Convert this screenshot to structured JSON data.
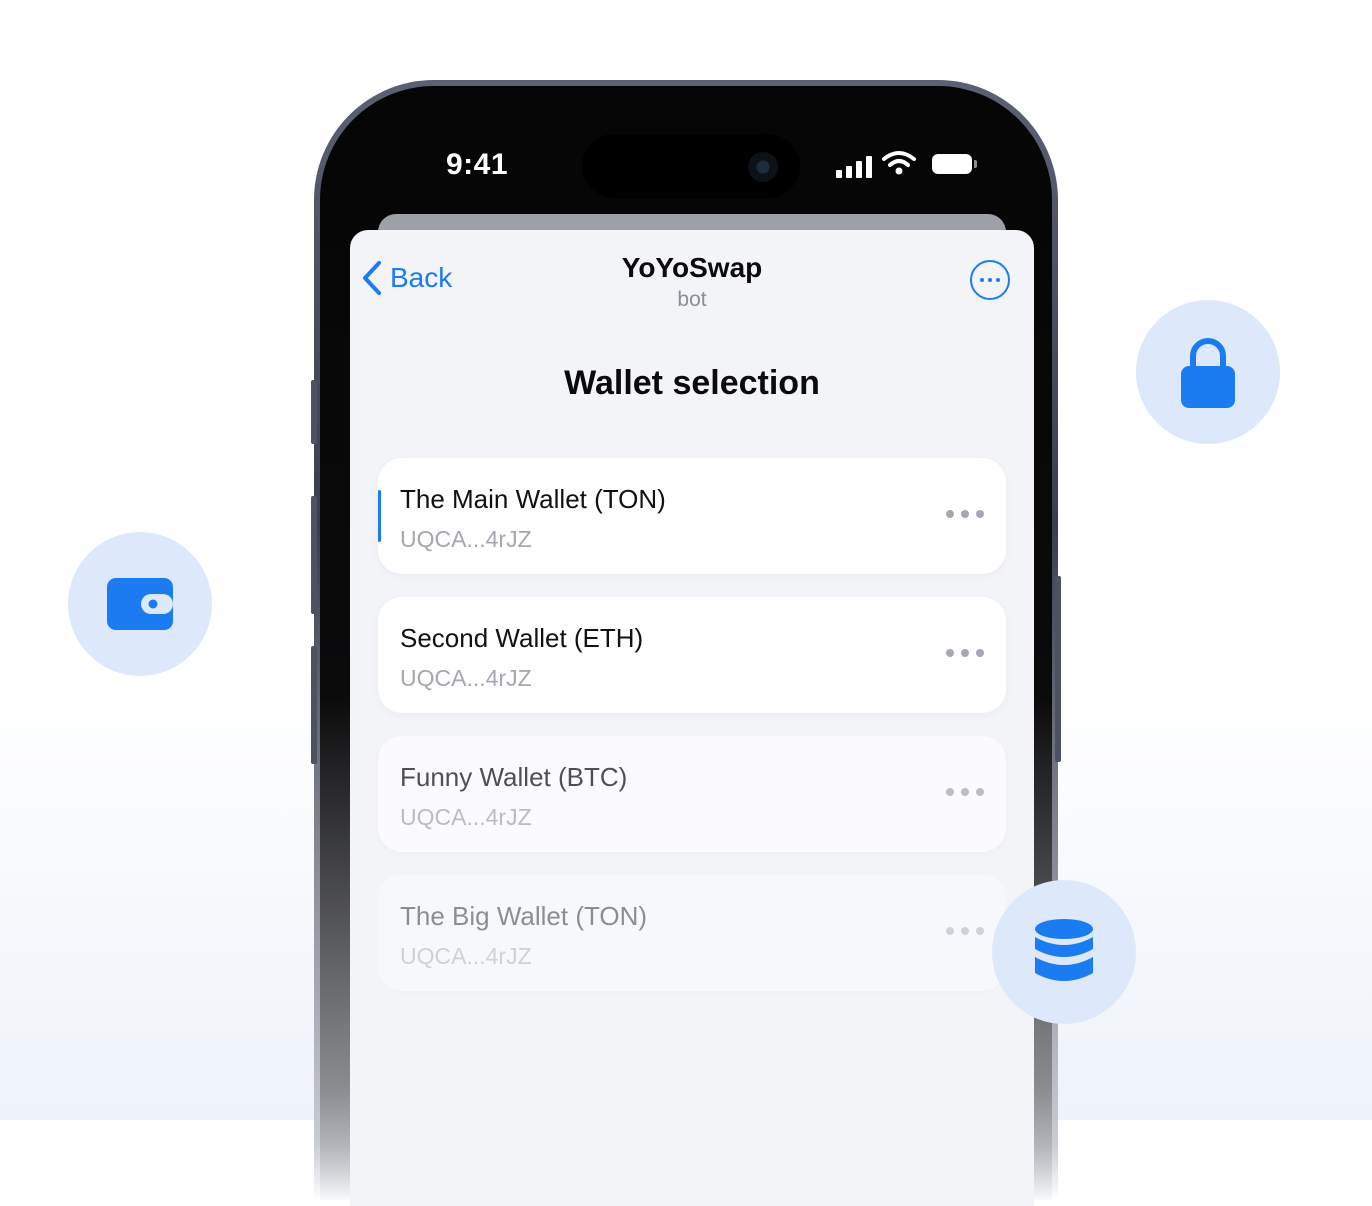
{
  "status_bar": {
    "time": "9:41"
  },
  "nav": {
    "back_label": "Back",
    "title": "YoYoSwap",
    "subtitle": "bot"
  },
  "page": {
    "title": "Wallet selection"
  },
  "wallets": [
    {
      "name": "The Main Wallet (TON)",
      "address": "UQCA...4rJZ"
    },
    {
      "name": "Second Wallet (ETH)",
      "address": "UQCA...4rJZ"
    },
    {
      "name": "Funny Wallet (BTC)",
      "address": "UQCA...4rJZ"
    },
    {
      "name": "The Big Wallet (TON)",
      "address": "UQCA...4rJZ"
    }
  ],
  "icons": {
    "wallet": "wallet-icon",
    "lock": "lock-icon",
    "database": "database-icon"
  },
  "colors": {
    "accent": "#1a7cf0",
    "bubble": "#dde9fa"
  }
}
